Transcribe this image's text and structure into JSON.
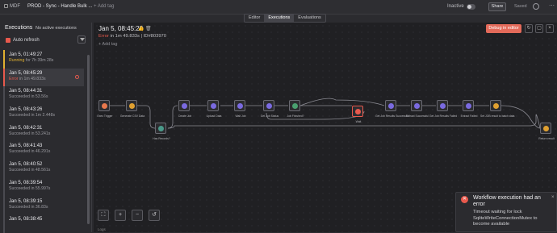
{
  "topbar": {
    "project": "MDF",
    "workflow_title": "PROD - Sync - Handle Bulk ...",
    "add_tag": "+ Add tag",
    "inactive_label": "Inactive",
    "share_label": "Share",
    "saved_label": "Saved",
    "more_glyph": "⋯"
  },
  "tabs": [
    "Editor",
    "Executions",
    "Evaluations"
  ],
  "sidebar": {
    "title": "Executions",
    "no_active": "No active executions",
    "auto_refresh": "Auto refresh",
    "items": [
      {
        "date": "Jan 5, 01:49:27",
        "status_key": "Running",
        "status_rest": " for 7h 39m 28s",
        "kind": "run"
      },
      {
        "date": "Jan 5, 08:45:29",
        "status_key": "Error",
        "status_rest": " in 1m 49.833s",
        "kind": "err"
      },
      {
        "date": "Jan 5, 08:44:31",
        "status_key": "Succeeded",
        "status_rest": " in 53.56s",
        "kind": "ok"
      },
      {
        "date": "Jan 5, 08:43:26",
        "status_key": "Succeeded",
        "status_rest": " in 1m 2.448s",
        "kind": "ok"
      },
      {
        "date": "Jan 5, 08:42:31",
        "status_key": "Succeeded",
        "status_rest": " in 53.241s",
        "kind": "ok"
      },
      {
        "date": "Jan 5, 08:41:43",
        "status_key": "Succeeded",
        "status_rest": " in 46.291s",
        "kind": "ok"
      },
      {
        "date": "Jan 5, 08:40:52",
        "status_key": "Succeeded",
        "status_rest": " in 48.561s",
        "kind": "ok"
      },
      {
        "date": "Jan 5, 08:39:54",
        "status_key": "Succeeded",
        "status_rest": " in 55.997s",
        "kind": "ok"
      },
      {
        "date": "Jan 5, 08:39:15",
        "status_key": "Succeeded",
        "status_rest": " in 36.83s",
        "kind": "ok"
      },
      {
        "date": "Jan 5, 08:38:45",
        "status_key": "",
        "status_rest": "",
        "kind": "ok"
      }
    ]
  },
  "execution": {
    "title": "Jan 5, 08:45:29",
    "status_error": "Error",
    "status_rest": " in 1m 49.833s | ID#803970",
    "add_tag": "+ Add tag",
    "debug_button": "Debug in editor"
  },
  "nodes": [
    {
      "label": "Exec Trigger",
      "color": "#e8784d"
    },
    {
      "label": "Generate CSV Data",
      "color": "#e0a030"
    },
    {
      "label": "Has Records?",
      "color": "#4a9a8a"
    },
    {
      "label": "Create Job",
      "color": "#7a6ae0"
    },
    {
      "label": "Upload Data",
      "color": "#7a6ae0"
    },
    {
      "label": "Wait Job",
      "color": "#7a6ae0"
    },
    {
      "label": "Get Job Status",
      "color": "#7a6ae0"
    },
    {
      "label": "Job Finished?",
      "color": "#4aa070"
    },
    {
      "label": "Wait",
      "color": "#e8594d"
    },
    {
      "label": "Get Job Results Successful",
      "color": "#7a6ae0"
    },
    {
      "label": "Extract Successful",
      "color": "#7a6ae0"
    },
    {
      "label": "Get Job Results Failed",
      "color": "#7a6ae0"
    },
    {
      "label": "Extract Failed",
      "color": "#7a6ae0"
    },
    {
      "label": "Set JOB result to batch data",
      "color": "#e0a030"
    },
    {
      "label": "Return result",
      "color": "#e0a030"
    }
  ],
  "edge_labels": [
    "Done",
    "true",
    "false",
    "Done",
    "Done",
    "Done",
    "true",
    "false",
    "Done",
    "Done",
    "Done",
    "Done",
    "Done"
  ],
  "zoom_controls": [
    "⛶",
    "+",
    "−",
    "↺"
  ],
  "logs_label": "Logs",
  "toast": {
    "title": "Workflow execution had an error",
    "message": "Timeout waiting for lock SqliteWriteConnectionMutex to become available",
    "close": "×"
  }
}
